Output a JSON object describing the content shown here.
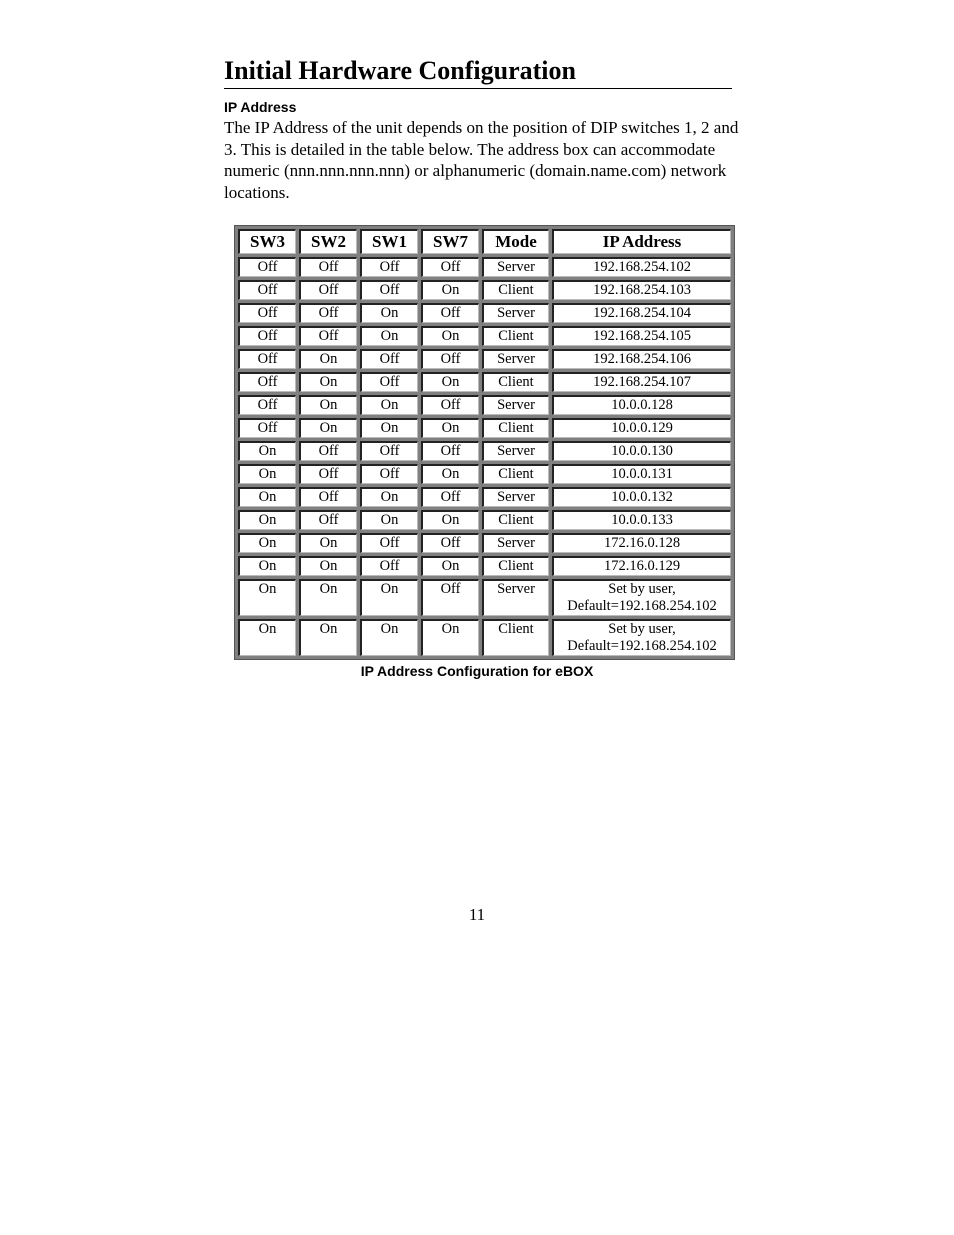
{
  "page": {
    "title": "Initial Hardware Configuration",
    "section_heading": "IP Address",
    "paragraph": "The IP Address of the unit depends on the position of DIP switches 1, 2 and 3.  This is detailed in the table below.  The address box can accommodate numeric (nnn.nnn.nnn.nnn) or alphanumeric (domain.name.com) network locations.",
    "caption": "IP Address Configuration for eBOX",
    "page_number": "11"
  },
  "table": {
    "headers": [
      "SW3",
      "SW2",
      "SW1",
      "SW7",
      "Mode",
      "IP Address"
    ],
    "rows": [
      [
        "Off",
        "Off",
        "Off",
        "Off",
        "Server",
        "192.168.254.102"
      ],
      [
        "Off",
        "Off",
        "Off",
        "On",
        "Client",
        "192.168.254.103"
      ],
      [
        "Off",
        "Off",
        "On",
        "Off",
        "Server",
        "192.168.254.104"
      ],
      [
        "Off",
        "Off",
        "On",
        "On",
        "Client",
        "192.168.254.105"
      ],
      [
        "Off",
        "On",
        "Off",
        "Off",
        "Server",
        "192.168.254.106"
      ],
      [
        "Off",
        "On",
        "Off",
        "On",
        "Client",
        "192.168.254.107"
      ],
      [
        "Off",
        "On",
        "On",
        "Off",
        "Server",
        "10.0.0.128"
      ],
      [
        "Off",
        "On",
        "On",
        "On",
        "Client",
        "10.0.0.129"
      ],
      [
        "On",
        "Off",
        "Off",
        "Off",
        "Server",
        "10.0.0.130"
      ],
      [
        "On",
        "Off",
        "Off",
        "On",
        "Client",
        "10.0.0.131"
      ],
      [
        "On",
        "Off",
        "On",
        "Off",
        "Server",
        "10.0.0.132"
      ],
      [
        "On",
        "Off",
        "On",
        "On",
        "Client",
        "10.0.0.133"
      ],
      [
        "On",
        "On",
        "Off",
        "Off",
        "Server",
        "172.16.0.128"
      ],
      [
        "On",
        "On",
        "Off",
        "On",
        "Client",
        "172.16.0.129"
      ],
      [
        "On",
        "On",
        "On",
        "Off",
        "Server",
        "Set by user, Default=192.168.254.102"
      ],
      [
        "On",
        "On",
        "On",
        "On",
        "Client",
        "Set by user, Default=192.168.254.102"
      ]
    ]
  }
}
